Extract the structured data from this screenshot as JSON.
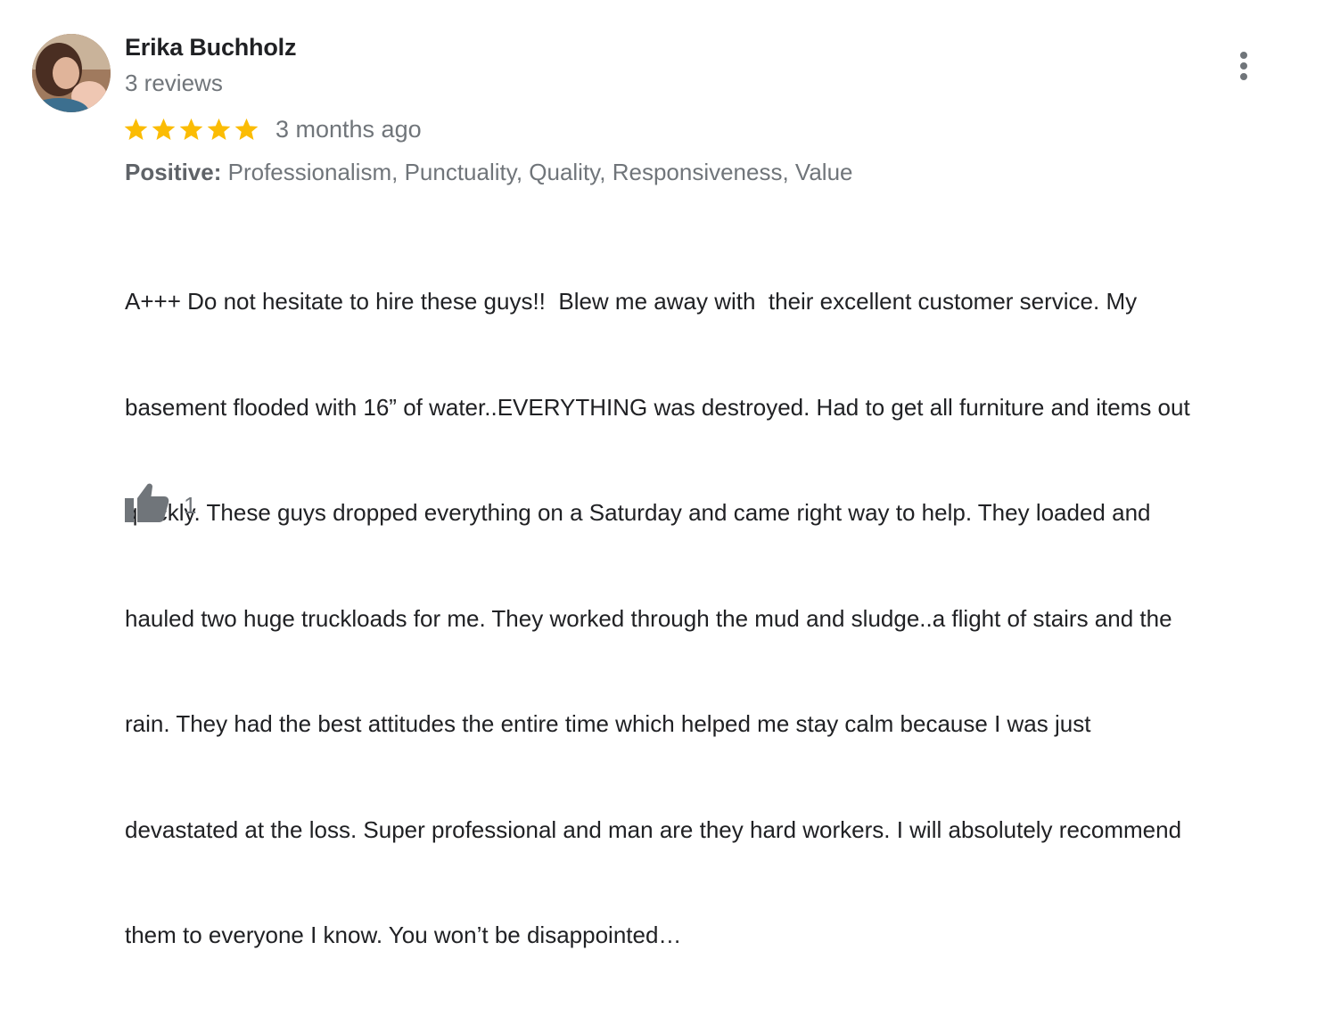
{
  "reviewer": {
    "name": "Erika Buchholz",
    "review_count": "3 reviews",
    "avatar_icon": "profile-photo"
  },
  "rating": {
    "stars": 5,
    "max_stars": 5,
    "star_color": "#fbbc04",
    "date": "3 months ago"
  },
  "attributes": {
    "label": "Positive:",
    "values": "Professionalism, Punctuality, Quality, Responsiveness, Value"
  },
  "review": {
    "lines": [
      "A+++ Do not hesitate to hire these guys!!  Blew me away with  their excellent customer service. My",
      "basement flooded with 16” of water..EVERYTHING was destroyed. Had to get all furniture and items out",
      "quickly. These guys dropped everything on a Saturday and came right way to help. They loaded and",
      "hauled two huge truckloads for me. They worked through the mud and sludge..a flight of stairs and the",
      "rain. They had the best attitudes the entire time which helped me stay calm because I was just",
      "devastated at the loss. Super professional and man are they hard workers. I will absolutely recommend",
      "them to everyone I know. You won’t be disappointed…"
    ]
  },
  "actions": {
    "like_icon": "thumbs-up-icon",
    "like_count": "1",
    "more_icon": "more-vert-icon"
  },
  "colors": {
    "primary_text": "#202124",
    "secondary_text": "#70757a",
    "icon_gray": "#70757a"
  }
}
